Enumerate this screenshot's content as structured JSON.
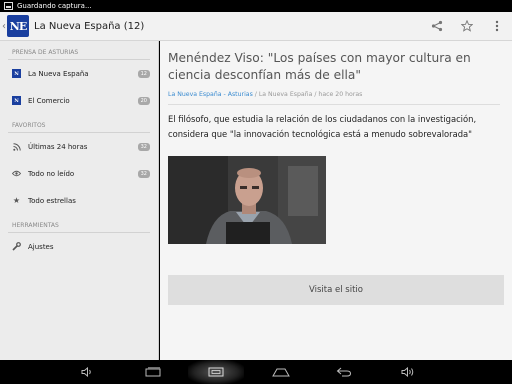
{
  "status_bar": {
    "notification": "Guardando captura..."
  },
  "action_bar": {
    "logo_text": "NE",
    "title": "La Nueva España (12)",
    "icons": [
      "share-icon",
      "star-icon",
      "overflow-menu-icon"
    ]
  },
  "sidebar": {
    "sections": [
      {
        "header": "PRENSA DE ASTURIAS",
        "items": [
          {
            "label": "La Nueva España",
            "count": "12",
            "icon": "newspaper-icon"
          },
          {
            "label": "El Comercio",
            "count": "20",
            "icon": "newspaper-icon"
          }
        ]
      },
      {
        "header": "FAVORITOS",
        "items": [
          {
            "label": "Últimas 24 horas",
            "count": "32",
            "icon": "rss-icon"
          },
          {
            "label": "Todo no leído",
            "count": "32",
            "icon": "eye-icon"
          },
          {
            "label": "Todo estrellas",
            "count": "",
            "icon": "star-icon"
          }
        ]
      },
      {
        "header": "HERRAMIENTAS",
        "items": [
          {
            "label": "Ajustes",
            "count": "",
            "icon": "wrench-icon"
          }
        ]
      }
    ]
  },
  "article": {
    "headline": "Menéndez Viso: \"Los países con mayor cultura en ciencia desconfían más de ella\"",
    "source": "La Nueva España - Asturias",
    "meta_rest": " / La Nueva España / hace 20 horas",
    "summary": "El filósofo, que estudia la relación de los ciudadanos con la investigación, considera que \"la innovación tecnológica está a menudo sobrevalorada\"",
    "visit_label": "Visita el sitio"
  },
  "nav_bar": {
    "icons": [
      "volume-down-icon",
      "back-icon",
      "home-icon",
      "recent-apps-icon",
      "screenshot-icon",
      "volume-up-icon"
    ]
  },
  "colors": {
    "brand": "#1a3f9f",
    "link": "#3a8bd0"
  }
}
